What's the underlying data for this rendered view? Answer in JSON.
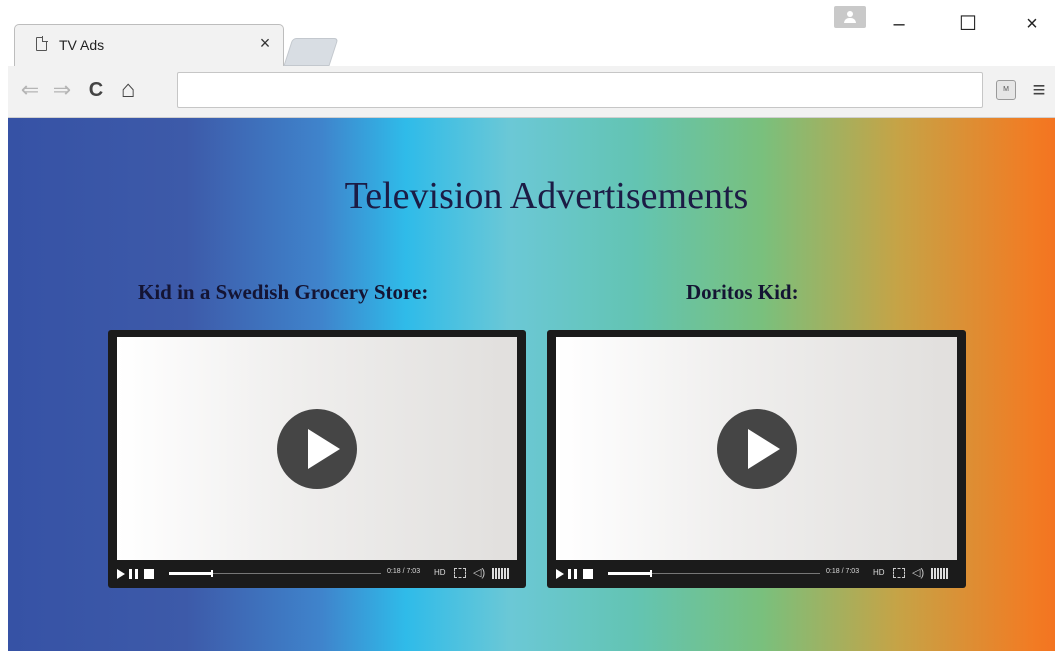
{
  "browser": {
    "tab": {
      "title": "TV Ads",
      "close_glyph": "×",
      "icon": "page-icon"
    },
    "window_controls": {
      "minimize": "–",
      "maximize": "☐",
      "close": "×"
    },
    "toolbar": {
      "back": "⇐",
      "forward": "⇒",
      "reload": "C",
      "home": "⌂",
      "address_value": "",
      "extension_label": "M",
      "menu": "≡"
    }
  },
  "page": {
    "heading": "Television Advertisements",
    "videos": [
      {
        "title": "Kid in a Swedish Grocery Store:",
        "time": "0:18 / 7:03",
        "quality": "HD",
        "progress": 0.2
      },
      {
        "title": "Doritos Kid:",
        "time": "0:18 / 7:03",
        "quality": "HD",
        "progress": 0.2
      }
    ]
  },
  "colors": {
    "gradient": [
      "#3652a5",
      "#2fbbe9",
      "#63c4b2",
      "#f37421"
    ],
    "player_frame": "#1b1b1b",
    "play_button": "#454545"
  }
}
